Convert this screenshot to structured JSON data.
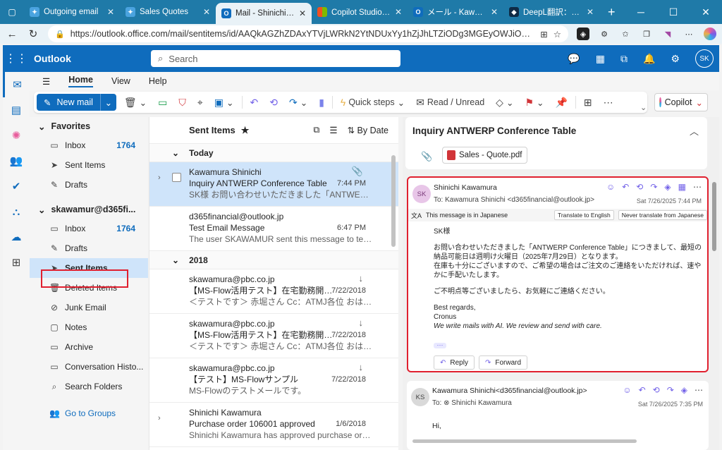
{
  "browser": {
    "tabs": [
      {
        "title": "Outgoing email",
        "color": "#4aa3df"
      },
      {
        "title": "Sales Quotes",
        "color": "#4aa3df"
      },
      {
        "title": "Mail - Shinichi Kawamura",
        "color": "#0f6cbd"
      },
      {
        "title": "Copilot Studio のライセンス",
        "color": "#f25022"
      },
      {
        "title": "メール - Kawamura Shinichi",
        "color": "#0f6cbd"
      },
      {
        "title": "DeepL翻訳：高精度な翻訳",
        "color": "#0f2b46"
      }
    ],
    "url": "https://outlook.office.com/mail/sentitems/id/AAQkAGZhZDAxYTVjLWRkN2YtNDUxYy1hZjJhLTZiODg3MGEyOWJiOQAQAGEa1PXI7CZKm..."
  },
  "header": {
    "app_name": "Outlook",
    "search_placeholder": "Search",
    "avatar_initials": "SK"
  },
  "ribbon": {
    "tabs": [
      "Home",
      "View",
      "Help"
    ],
    "new_mail": "New mail",
    "quick_steps": "Quick steps",
    "read_unread": "Read / Unread",
    "copilot": "Copilot"
  },
  "folders": {
    "favorites_title": "Favorites",
    "favorites": [
      {
        "label": "Inbox",
        "count": "1764",
        "icon": "inbox-icon"
      },
      {
        "label": "Sent Items",
        "count": "",
        "icon": "send-icon"
      },
      {
        "label": "Drafts",
        "count": "",
        "icon": "pencil-icon"
      }
    ],
    "account_title": "skawamur@d365fi...",
    "account": [
      {
        "label": "Inbox",
        "count": "1764"
      },
      {
        "label": "Drafts",
        "count": ""
      },
      {
        "label": "Sent Items",
        "count": ""
      },
      {
        "label": "Deleted Items",
        "count": ""
      },
      {
        "label": "Junk Email",
        "count": ""
      },
      {
        "label": "Notes",
        "count": ""
      },
      {
        "label": "Archive",
        "count": ""
      },
      {
        "label": "Conversation Histo...",
        "count": ""
      },
      {
        "label": "Search Folders",
        "count": ""
      }
    ],
    "go_to_groups": "Go to Groups"
  },
  "list": {
    "title": "Sent Items",
    "sort": "By Date",
    "groups": [
      {
        "label": "Today",
        "messages": [
          {
            "sender": "Kawamura Shinichi",
            "subject": "Inquiry ANTWERP Conference Table",
            "preview": "SK様 お問い合わせいただきました「ANTWERP C...",
            "time": "7:44 PM",
            "selected": true,
            "attachment": true
          },
          {
            "sender": "d365financial@outlook.jp",
            "subject": "Test Email Message",
            "preview": "The user SKAWAMUR sent this message to test th...",
            "time": "6:47 PM"
          }
        ]
      },
      {
        "label": "2018",
        "messages": [
          {
            "sender": "skawamura@pbc.co.jp",
            "subject": "【MS-Flow活用テスト】在宅勤務開始...",
            "preview": "＜テストです＞ 赤堀さん Cc：ATMJ各位 おはよ...",
            "time": "7/22/2018",
            "arrow": true
          },
          {
            "sender": "skawamura@pbc.co.jp",
            "subject": "【MS-Flow活用テスト】在宅勤務開始...",
            "preview": "＜テストです＞ 赤堀さん Cc：ATMJ各位 おはよ...",
            "time": "7/22/2018",
            "arrow": true
          },
          {
            "sender": "skawamura@pbc.co.jp",
            "subject": "【テスト】MS-Flowサンプル",
            "preview": "MS-Flowのテストメールです。",
            "time": "7/22/2018",
            "arrow": true
          },
          {
            "sender": "Shinichi Kawamura",
            "subject": "Purchase order 106001 approved",
            "preview": "Shinichi Kawamura has approved purchase order ...",
            "time": "1/6/2018",
            "expand": true
          }
        ]
      }
    ]
  },
  "reading": {
    "subject": "Inquiry ANTWERP Conference Table",
    "attachment": "Sales - Quote.pdf",
    "message1": {
      "avatar": "SK",
      "from": "Shinichi Kawamura",
      "to": "To:  Kawamura Shinichi <d365financial@outlook.jp>",
      "date": "Sat 7/26/2025 7:44 PM",
      "lang_notice": "This message is in Japanese",
      "translate": "Translate to English",
      "never_translate": "Never translate from Japanese",
      "greeting": "SK様",
      "para1": "お問い合わせいただきました「ANTWERP Conference Table」につきまして、最短の納品可能日は週明け火曜日（2025年7月29日）となります。",
      "para2": "在庫も十分にございますので、ご希望の場合はご注文のご連絡をいただければ、速やかに手配いたします。",
      "para3": "ご不明点等ございましたら、お気軽にご連絡ください。",
      "regards": "Best regards,",
      "company": "Cronus",
      "tagline": "We write mails with AI. We review and send with care.",
      "reply": "Reply",
      "forward": "Forward"
    },
    "message2": {
      "avatar": "KS",
      "from": "Kawamura Shinichi<d365financial@outlook.jp>",
      "to": "To:  ⊗ Shinichi Kawamura",
      "date": "Sat 7/26/2025 7:35 PM",
      "greeting": "Hi,"
    }
  }
}
